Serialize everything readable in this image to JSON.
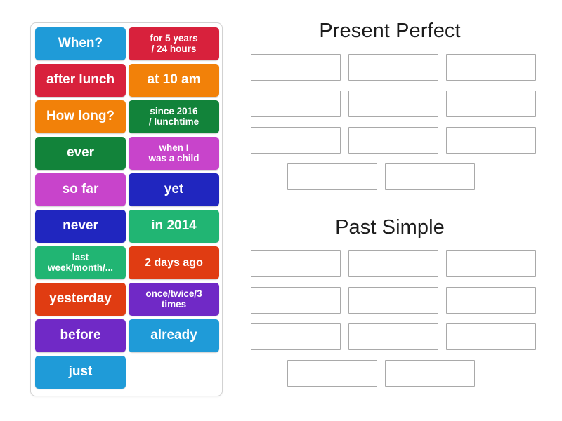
{
  "activity": {
    "type": "group-sort",
    "word_bank": {
      "tiles": [
        {
          "label": "When?",
          "color": "#1f9bd8",
          "size": "lg"
        },
        {
          "label": "for 5 years\n/ 24 hours",
          "color": "#d8213c",
          "size": "sm"
        },
        {
          "label": "after lunch",
          "color": "#d8213c",
          "size": "lg"
        },
        {
          "label": "at 10 am",
          "color": "#f28109",
          "size": "lg"
        },
        {
          "label": "How long?",
          "color": "#f28109",
          "size": "lg"
        },
        {
          "label": "since 2016\n/ lunchtime",
          "color": "#12833a",
          "size": "sm"
        },
        {
          "label": "ever",
          "color": "#12833a",
          "size": "lg"
        },
        {
          "label": "when I\nwas a child",
          "color": "#c844cb",
          "size": "sm"
        },
        {
          "label": "so far",
          "color": "#c844cb",
          "size": "lg"
        },
        {
          "label": "yet",
          "color": "#2026bf",
          "size": "lg"
        },
        {
          "label": "never",
          "color": "#2026bf",
          "size": "lg"
        },
        {
          "label": "in 2014",
          "color": "#21b573",
          "size": "lg"
        },
        {
          "label": "last\nweek/month/...",
          "color": "#21b573",
          "size": "sm"
        },
        {
          "label": "2 days ago",
          "color": "#e03c12",
          "size": "md"
        },
        {
          "label": "yesterday",
          "color": "#e03c12",
          "size": "lg"
        },
        {
          "label": "once/twice/3\ntimes",
          "color": "#7029c6",
          "size": "sm"
        },
        {
          "label": "before",
          "color": "#7029c6",
          "size": "lg"
        },
        {
          "label": "already",
          "color": "#1f9bd8",
          "size": "lg"
        },
        {
          "label": "just",
          "color": "#1f9bd8",
          "size": "lg"
        }
      ]
    },
    "categories": [
      {
        "id": "present-perfect",
        "title": "Present Perfect",
        "slot_rows": [
          3,
          3,
          3
        ],
        "last_row_slots": 2,
        "total_slots": 11
      },
      {
        "id": "past-simple",
        "title": "Past Simple",
        "slot_rows": [
          3,
          3,
          3
        ],
        "last_row_slots": 2,
        "total_slots": 11
      }
    ],
    "colors": {
      "tile_border_shadow": "#00000030",
      "slot_border": "#a9a9a9",
      "panel_border": "#d2d2d2",
      "title_text": "#1c1c1c",
      "background": "#ffffff"
    }
  }
}
